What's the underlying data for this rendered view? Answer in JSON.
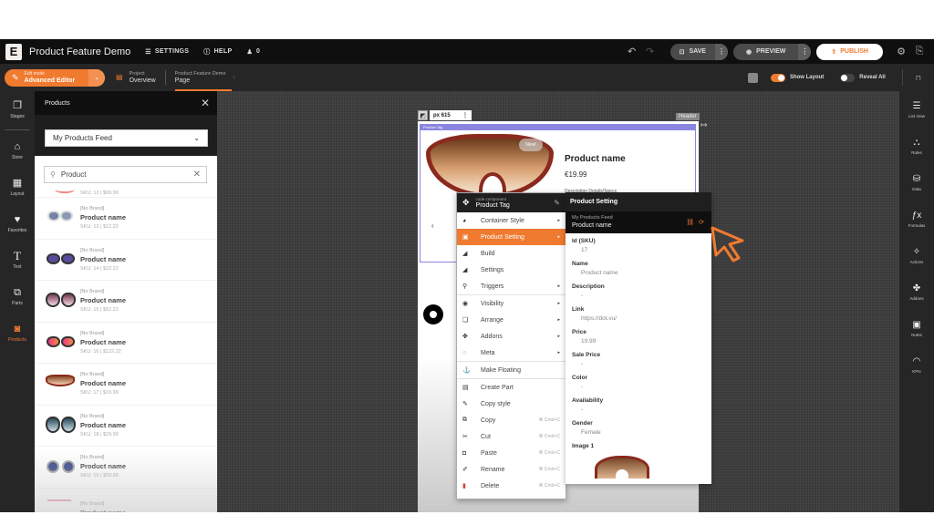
{
  "app": {
    "logo": "E",
    "title": "Product Feature Demo",
    "settings_label": "SETTINGS",
    "help_label": "HELP",
    "users_count": "0",
    "save_label": "SAVE",
    "preview_label": "PREVIEW",
    "publish_label": "PUBLISH"
  },
  "subbar": {
    "edit_mode_caption": "Edit mode",
    "edit_mode_value": "Advanced Editor",
    "project_caption": "Project",
    "project_value": "Overview",
    "page_caption": "Product Feature Demo",
    "page_value": "Page",
    "show_layout_label": "Show Layout",
    "show_layout_on": true,
    "reveal_all_label": "Reveal All",
    "reveal_all_on": false
  },
  "left_rail": [
    {
      "icon": "stages-icon",
      "glyph": "❐",
      "label": "Stages"
    },
    {
      "icon": "store-icon",
      "glyph": "⌂",
      "label": "Store"
    },
    {
      "icon": "layout-icon",
      "glyph": "▦",
      "label": "Layout"
    },
    {
      "icon": "heart-icon",
      "glyph": "♥",
      "label": "Favorites"
    },
    {
      "icon": "text-icon",
      "glyph": "T",
      "label": "Text"
    },
    {
      "icon": "parts-icon",
      "glyph": "⧉",
      "label": "Parts"
    },
    {
      "icon": "products-icon",
      "glyph": "◙",
      "label": "Products"
    }
  ],
  "products_panel": {
    "title": "Products",
    "feed_selected": "My Products Feed",
    "search_value": "Product",
    "first_partial_sku": "SKU: 12 | $99.99",
    "items": [
      {
        "brand": "[No Brand]",
        "name": "Product name",
        "sku": "SKU: 13 | $12.22"
      },
      {
        "brand": "[No Brand]",
        "name": "Product name",
        "sku": "SKU: 14 | $22.22"
      },
      {
        "brand": "[No Brand]",
        "name": "Product name",
        "sku": "SKU: 15 | $52.22"
      },
      {
        "brand": "[No Brand]",
        "name": "Product name",
        "sku": "SKU: 16 | $122.22"
      },
      {
        "brand": "[No Brand]",
        "name": "Product name",
        "sku": "SKU: 17 | $19.99"
      },
      {
        "brand": "[No Brand]",
        "name": "Product name",
        "sku": "SKU: 18 | $29.99"
      },
      {
        "brand": "[No Brand]",
        "name": "Product name",
        "sku": "SKU: 19 | $59.99"
      },
      {
        "brand": "[No Brand]",
        "name": "Product name",
        "sku": ""
      }
    ]
  },
  "canvas": {
    "frame_width_label": "px 615",
    "header_tag": "Header",
    "component_label": "Product Tag",
    "new_badge": "New!",
    "product_name": "Product name",
    "product_price": "€19.99",
    "product_desc_cols": "Description      Details/Specs"
  },
  "context_menu": {
    "caption": "code component",
    "title": "Product Tag",
    "items": [
      {
        "label": "Container Style",
        "icon": "palette-icon",
        "glyph": "◕",
        "submenu": true
      },
      {
        "label": "Product Setting",
        "icon": "bag-icon",
        "glyph": "▣",
        "submenu": true,
        "active": true
      },
      {
        "label": "Build",
        "icon": "build-icon",
        "glyph": "◢",
        "submenu": false
      },
      {
        "label": "Settings",
        "icon": "settings-icon",
        "glyph": "◢",
        "submenu": false
      },
      {
        "label": "Triggers",
        "icon": "wand-icon",
        "glyph": "⚲",
        "submenu": true
      },
      {
        "label": "Visibility",
        "icon": "eye-icon",
        "glyph": "◉",
        "submenu": true
      },
      {
        "label": "Arrange",
        "icon": "arrange-icon",
        "glyph": "❏",
        "submenu": true
      },
      {
        "label": "Addons",
        "icon": "puzzle-icon",
        "glyph": "✤",
        "submenu": true
      },
      {
        "label": "Meta",
        "icon": "tag-icon",
        "glyph": "◌",
        "submenu": true
      },
      {
        "label": "Make Floating",
        "icon": "anchor-icon",
        "glyph": "⚓",
        "submenu": false
      },
      {
        "label": "Create Part",
        "icon": "create-part-icon",
        "glyph": "▤",
        "submenu": false
      },
      {
        "label": "Copy style",
        "icon": "brush-icon",
        "glyph": "✎",
        "submenu": false
      },
      {
        "label": "Copy",
        "icon": "copy-icon",
        "glyph": "⧉",
        "shortcut": "⌘ Cmd+C"
      },
      {
        "label": "Cut",
        "icon": "scissors-icon",
        "glyph": "✂",
        "shortcut": "⌘ Cmd+C"
      },
      {
        "label": "Paste",
        "icon": "paste-icon",
        "glyph": "◘",
        "shortcut": "⌘ Cmd+C"
      },
      {
        "label": "Rename",
        "icon": "rename-icon",
        "glyph": "✐",
        "shortcut": "⌘ Cmd+C"
      },
      {
        "label": "Delete",
        "icon": "trash-icon",
        "glyph": "▮",
        "shortcut": "⌘ Cmd+C"
      }
    ]
  },
  "product_setting": {
    "title": "Product Setting",
    "feed_caption": "My Products Feed",
    "feed_product": "Product name",
    "fields": [
      {
        "key": "Id (SKU)",
        "value": "17"
      },
      {
        "key": "Name",
        "value": "Product name"
      },
      {
        "key": "Description",
        "value": "-"
      },
      {
        "key": "Link",
        "value": "https://dot.vu/"
      },
      {
        "key": "Price",
        "value": "19.99"
      },
      {
        "key": "Sale Price",
        "value": "-"
      },
      {
        "key": "Color",
        "value": "-"
      },
      {
        "key": "Availability",
        "value": "-"
      },
      {
        "key": "Gender",
        "value": "Female"
      }
    ],
    "image_label": "Image 1"
  },
  "right_rail": [
    {
      "icon": "list-view-icon",
      "glyph": "☰",
      "label": "List View"
    },
    {
      "icon": "rules-icon",
      "glyph": "⛬",
      "label": "Rules"
    },
    {
      "icon": "data-icon",
      "glyph": "⛁",
      "label": "Data"
    },
    {
      "icon": "formulas-icon",
      "glyph": "ƒx",
      "label": "Formulas"
    },
    {
      "icon": "actions-icon",
      "glyph": "✧",
      "label": "Actions"
    },
    {
      "icon": "addons-icon",
      "glyph": "✤",
      "label": "Addons"
    },
    {
      "icon": "notes-icon",
      "glyph": "▣",
      "label": "Notes"
    },
    {
      "icon": "kpis-icon",
      "glyph": "◠",
      "label": "KPIs"
    }
  ],
  "colors": {
    "accent": "#f07a30",
    "dark": "#0f0f0f",
    "panel": "#262626",
    "component_outline": "#8a86e0"
  }
}
